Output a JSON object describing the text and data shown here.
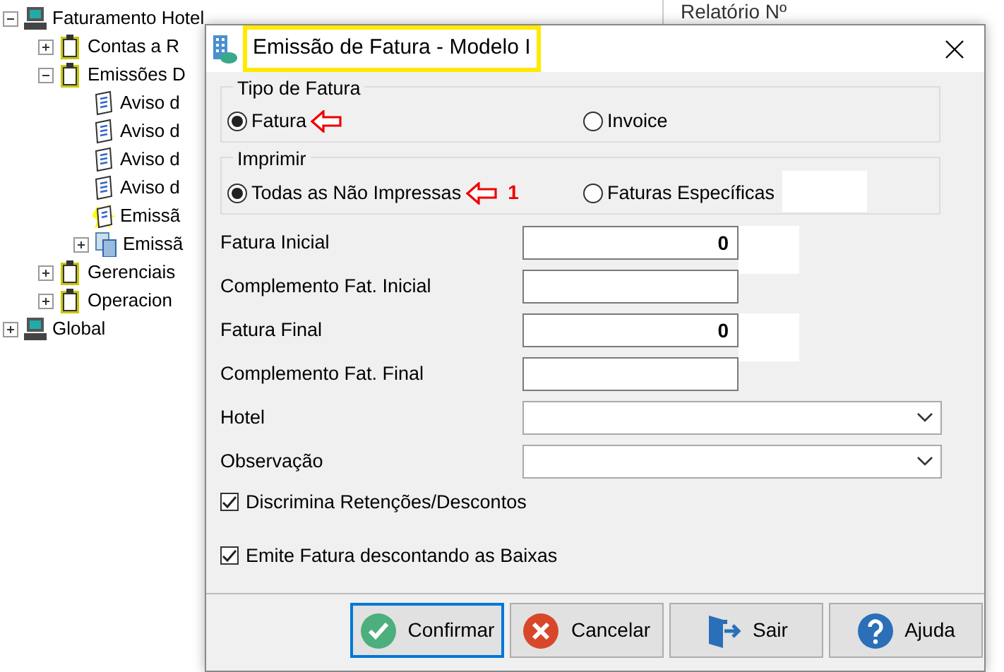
{
  "tree": [
    {
      "label": "Faturamento Hotel",
      "kind": "computer",
      "expanded": true,
      "children": [
        {
          "label": "Contas a R",
          "kind": "clipboard",
          "expanded": false
        },
        {
          "label": "Emissões D",
          "kind": "clipboard",
          "expanded": true,
          "children": [
            {
              "label": "Aviso d",
              "kind": "report"
            },
            {
              "label": "Aviso d",
              "kind": "report"
            },
            {
              "label": "Aviso d",
              "kind": "report"
            },
            {
              "label": "Aviso d",
              "kind": "report"
            },
            {
              "label": "Emissã",
              "kind": "report-star"
            },
            {
              "label": "Emissã",
              "kind": "pages",
              "expanded": false
            }
          ]
        },
        {
          "label": "Gerenciais",
          "kind": "clipboard",
          "expanded": false
        },
        {
          "label": "Operacion",
          "kind": "clipboard",
          "expanded": false
        }
      ]
    },
    {
      "label": "Global",
      "kind": "computer",
      "expanded": false
    }
  ],
  "panel": {
    "heading": "Relatório Nº"
  },
  "dialog": {
    "title": "Emissão de Fatura - Modelo I",
    "title_highlighted": true,
    "groups": [
      {
        "legend": "Tipo de Fatura",
        "options": [
          {
            "label": "Fatura",
            "selected": true,
            "arrow": true
          },
          {
            "label": "Invoice",
            "selected": false,
            "arrow": false
          }
        ]
      },
      {
        "legend": "Imprimir",
        "options": [
          {
            "label": "Todas as Não Impressas",
            "selected": true,
            "arrow": true,
            "note": "1"
          },
          {
            "label": "Faturas Específicas",
            "selected": false,
            "arrow": false
          }
        ]
      }
    ],
    "fields": [
      {
        "label": "Fatura Inicial",
        "kind": "number",
        "value": "0"
      },
      {
        "label": "Complemento Fat. Inicial",
        "kind": "text"
      },
      {
        "label": "Fatura Final",
        "kind": "number",
        "value": "0"
      },
      {
        "label": "Complemento Fat. Final",
        "kind": "text"
      },
      {
        "label": "Hotel",
        "kind": "select"
      },
      {
        "label": "Observação",
        "kind": "select"
      }
    ],
    "checkboxes": [
      {
        "label": "Discrimina Retenções/Descontos",
        "checked": true
      },
      {
        "label": "Emite Fatura descontando as Baixas",
        "checked": true
      }
    ],
    "buttons": [
      {
        "label": "Confirmar",
        "kind": "confirm",
        "focused": true
      },
      {
        "label": "Cancelar",
        "kind": "cancel",
        "focused": false
      },
      {
        "label": "Sair",
        "kind": "exit",
        "focused": false
      },
      {
        "label": "Ajuda",
        "kind": "help",
        "focused": false
      }
    ]
  }
}
